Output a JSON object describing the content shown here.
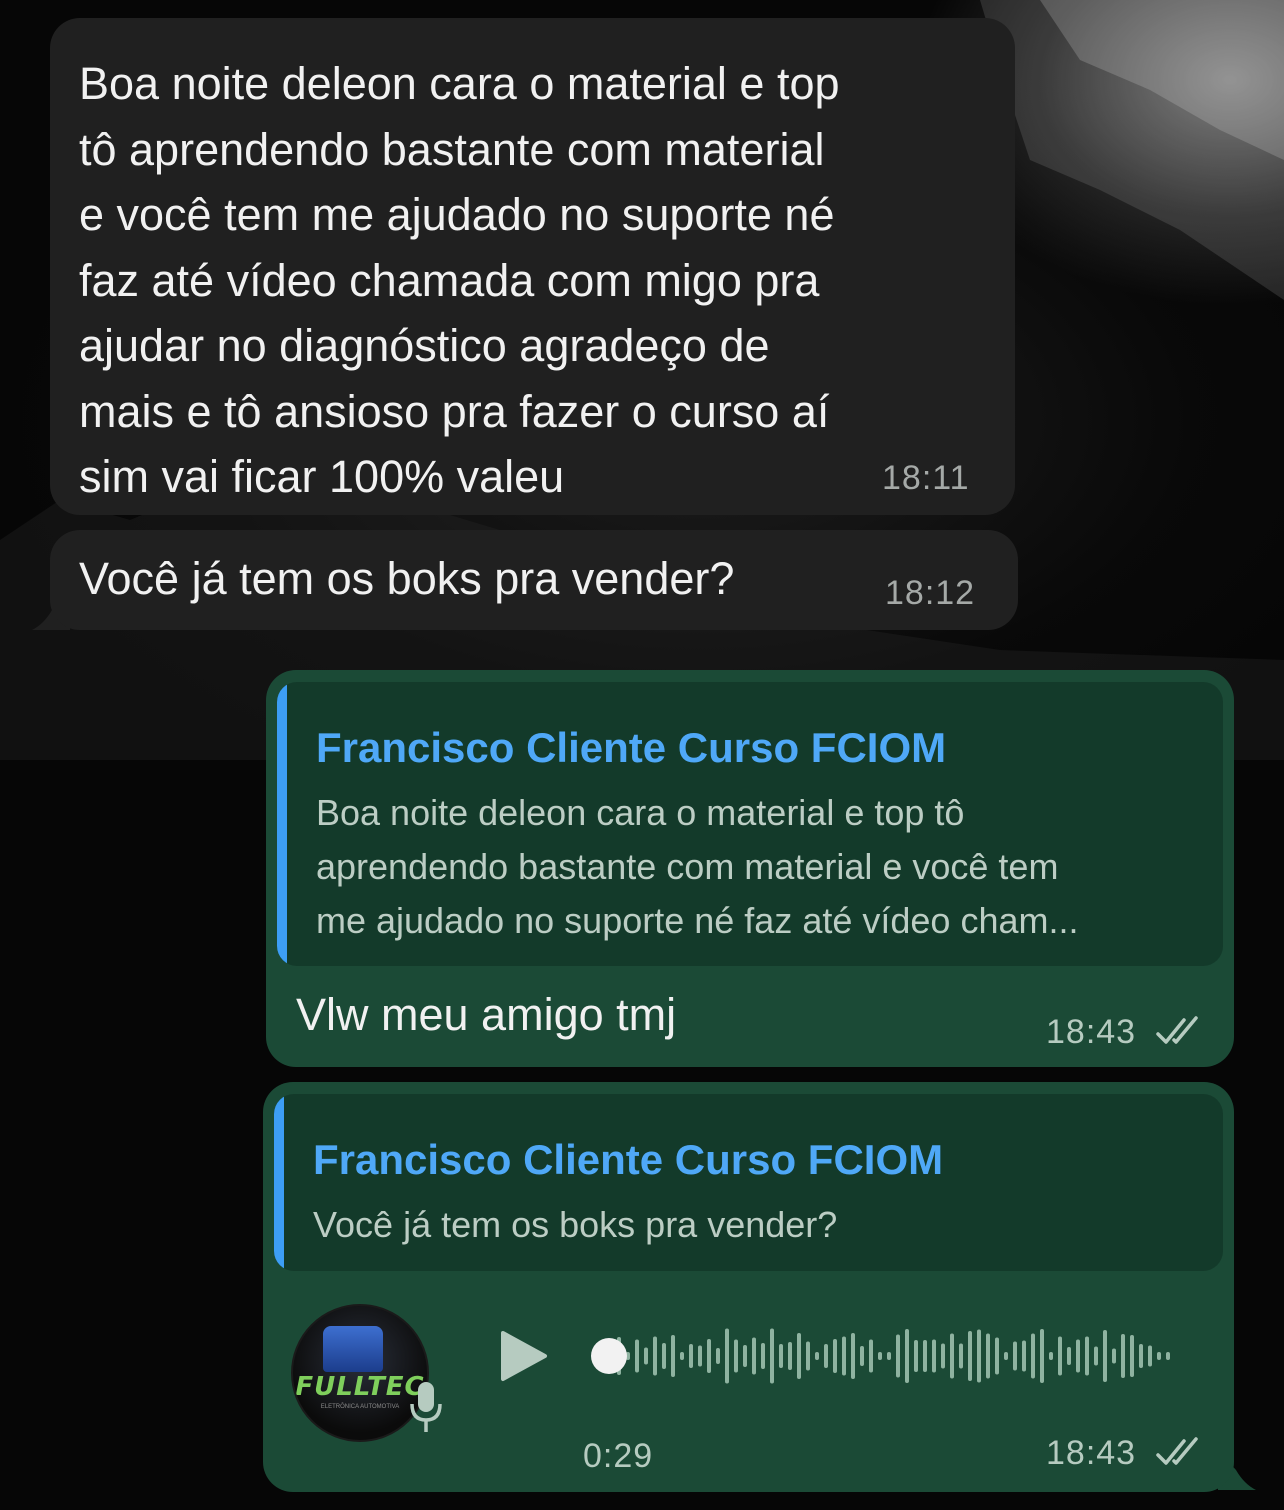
{
  "messages": [
    {
      "direction": "incoming",
      "lines": [
        "Boa noite deleon cara o material e top",
        "tô aprendendo bastante com material",
        "e você tem me ajudado no suporte né",
        "faz até vídeo chamada com migo pra",
        "ajudar no diagnóstico agradeço de",
        "mais e tô ansioso pra fazer o curso aí",
        "sim vai ficar 100% valeu"
      ],
      "time": "18:11"
    },
    {
      "direction": "incoming",
      "text": "Você já tem os boks pra vender?",
      "time": "18:12"
    },
    {
      "direction": "outgoing",
      "reply": {
        "author": "Francisco Cliente Curso FCIOM",
        "lines": [
          "Boa noite deleon cara o material e top tô",
          "aprendendo bastante com material e você tem",
          "me ajudado no suporte né faz até vídeo cham..."
        ]
      },
      "text": "Vlw meu amigo tmj",
      "time": "18:43",
      "status_icon": "double-check-icon"
    },
    {
      "direction": "outgoing",
      "reply": {
        "author": "Francisco Cliente Curso FCIOM",
        "text": "Você já tem os boks pra vender?"
      },
      "voice": {
        "duration": "0:29",
        "progress": 0.0,
        "avatar_text": "FULLTEC",
        "avatar_subtext": "ELETRÔNICA AUTOMOTIVA",
        "play_icon": "play-icon",
        "mic_icon": "microphone-icon"
      },
      "time": "18:43",
      "status_icon": "double-check-icon"
    }
  ],
  "colors": {
    "incoming_bubble": "#202020",
    "outgoing_bubble": "#1b4a36",
    "quote_bg": "#133a2a",
    "quote_accent": "#3d9ef5",
    "author": "#4fa8f7"
  }
}
